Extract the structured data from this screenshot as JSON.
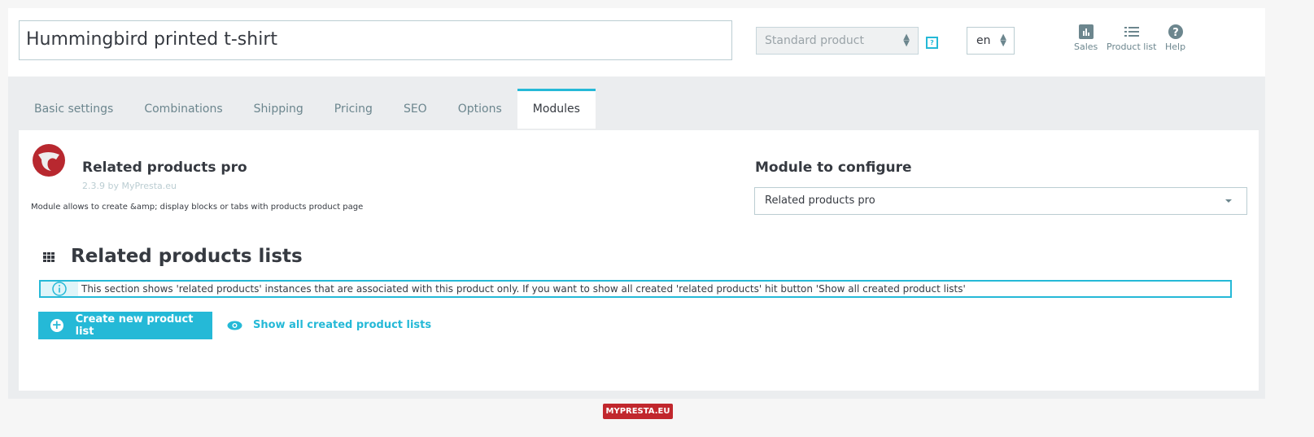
{
  "header": {
    "product_name": "Hummingbird printed t-shirt",
    "product_type": "Standard product",
    "help_glyph": "?",
    "language": "en",
    "quick_links": [
      {
        "label": "Sales",
        "icon": "bar-chart-icon"
      },
      {
        "label": "Product list",
        "icon": "list-icon"
      },
      {
        "label": "Help",
        "icon": "help-icon"
      }
    ]
  },
  "tabs": [
    {
      "label": "Basic settings"
    },
    {
      "label": "Combinations"
    },
    {
      "label": "Shipping"
    },
    {
      "label": "Pricing"
    },
    {
      "label": "SEO"
    },
    {
      "label": "Options"
    },
    {
      "label": "Modules",
      "active": true
    }
  ],
  "module": {
    "title": "Related products pro",
    "version": "2.3.9 by MyPresta.eu",
    "description": "Module allows to create &amp; display blocks or tabs with products product page"
  },
  "configure": {
    "label": "Module to configure",
    "selected": "Related products pro"
  },
  "section": {
    "title": "Related products lists",
    "info": "This section shows 'related products' instances that are associated with this product only. If you want to show all created 'related products' hit button 'Show all created product lists'",
    "create_button": "Create new product list",
    "show_all_link": "Show all created product lists"
  },
  "footer": {
    "logo_text": "MYPRESTA.EU"
  },
  "colors": {
    "accent": "#25b9d7",
    "brand_red": "#c1272d"
  }
}
